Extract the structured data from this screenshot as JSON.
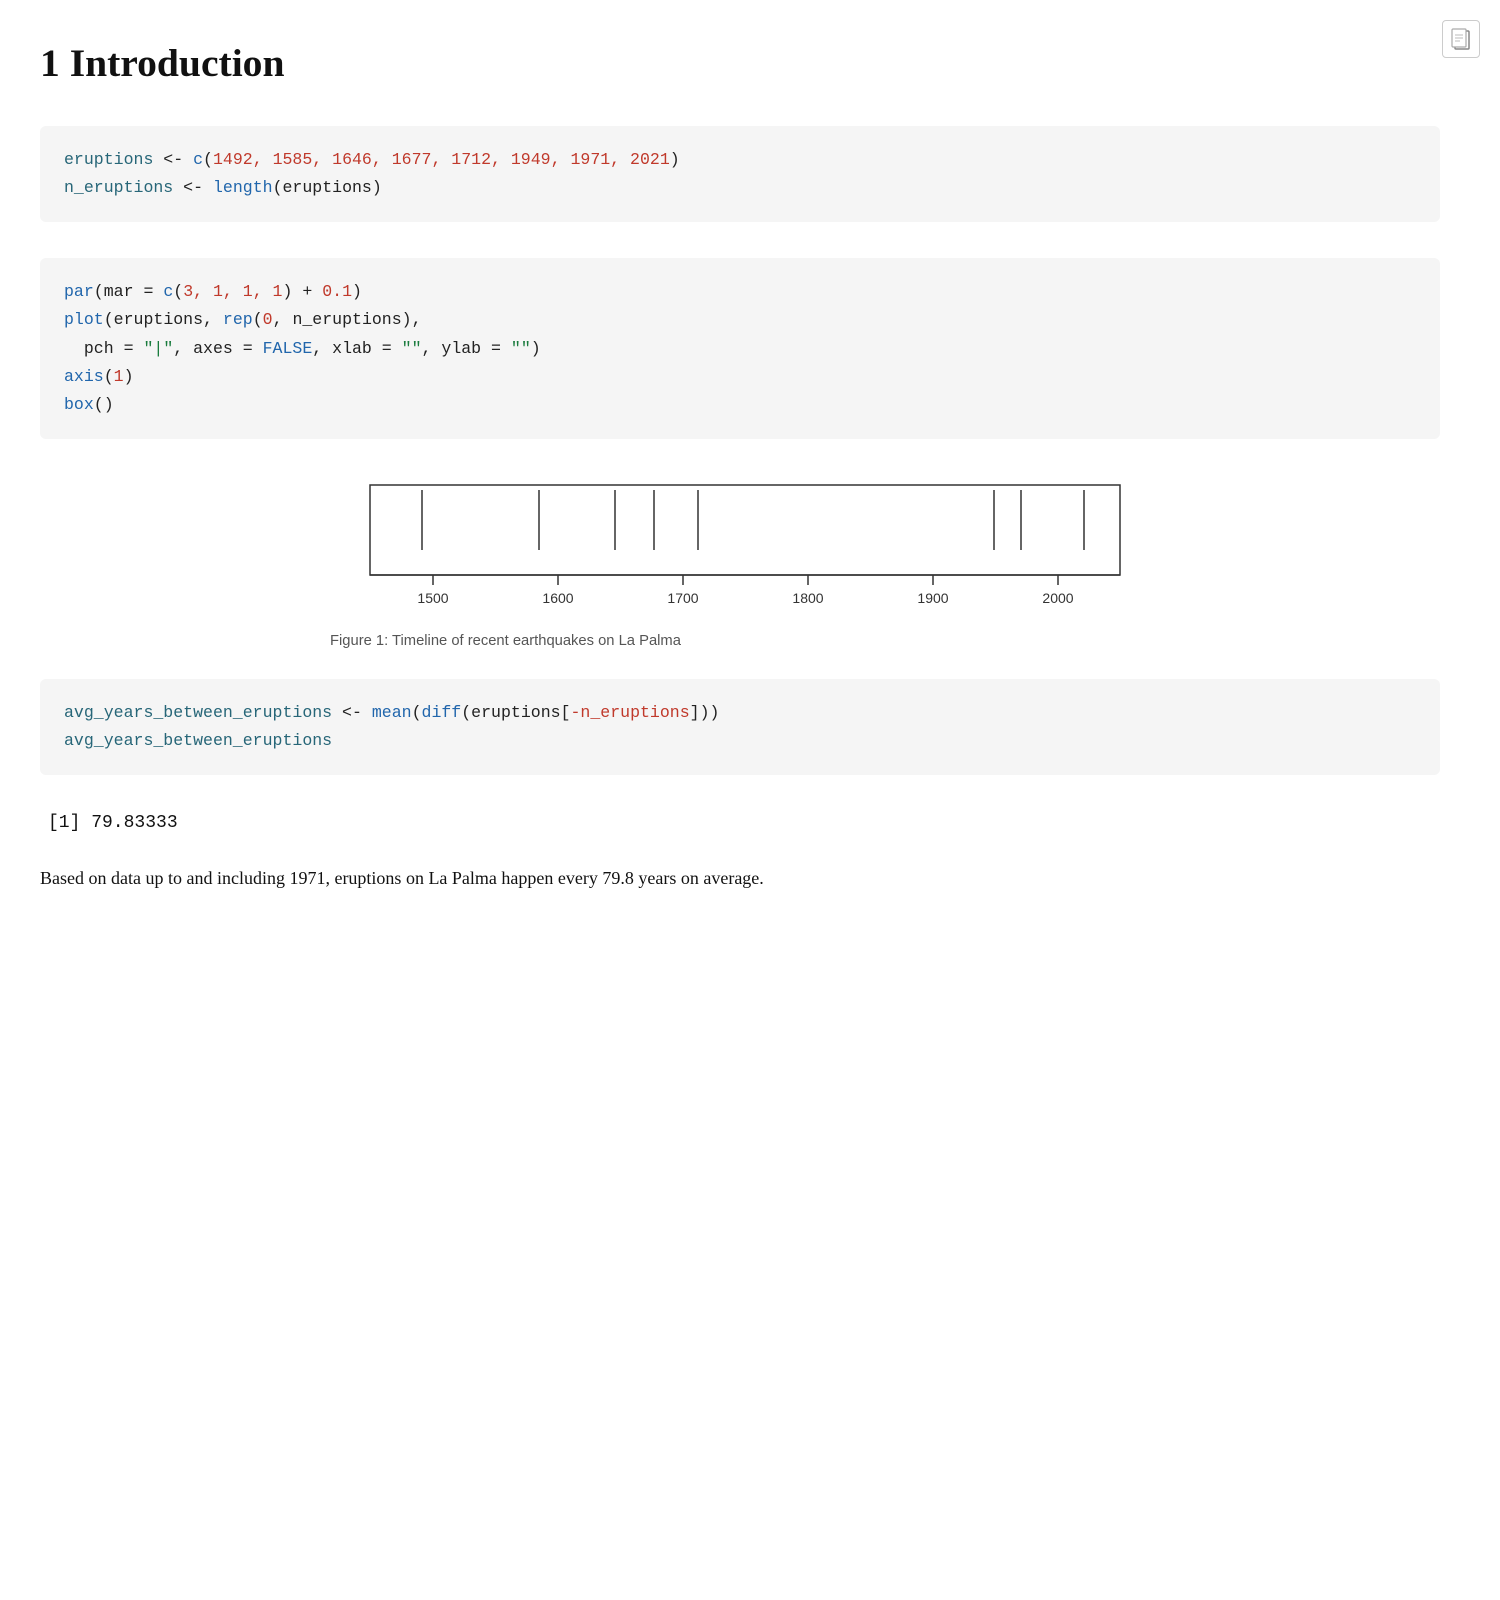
{
  "header": {
    "section_number": "1",
    "title": "Introduction"
  },
  "code_block_1": {
    "lines": [
      {
        "parts": [
          {
            "text": "eruptions",
            "class": "c-teal"
          },
          {
            "text": " <- ",
            "class": ""
          },
          {
            "text": "c",
            "class": "c-blue"
          },
          {
            "text": "(",
            "class": ""
          },
          {
            "text": "1492, 1585, 1646, 1677, 1712, 1949, 1971, 2021",
            "class": "c-red"
          },
          {
            "text": ")",
            "class": ""
          }
        ]
      },
      {
        "parts": [
          {
            "text": "n_eruptions",
            "class": "c-teal"
          },
          {
            "text": " <- ",
            "class": ""
          },
          {
            "text": "length",
            "class": "c-blue"
          },
          {
            "text": "(eruptions)",
            "class": ""
          }
        ]
      }
    ]
  },
  "code_block_2": {
    "lines": [
      {
        "parts": [
          {
            "text": "par",
            "class": "c-blue"
          },
          {
            "text": "(mar = ",
            "class": ""
          },
          {
            "text": "c",
            "class": "c-blue"
          },
          {
            "text": "(",
            "class": ""
          },
          {
            "text": "3, 1, 1, 1",
            "class": "c-red"
          },
          {
            "text": ") + ",
            "class": ""
          },
          {
            "text": "0.1",
            "class": "c-red"
          },
          {
            "text": ")",
            "class": ""
          }
        ]
      },
      {
        "parts": [
          {
            "text": "plot",
            "class": "c-blue"
          },
          {
            "text": "(eruptions, ",
            "class": ""
          },
          {
            "text": "rep",
            "class": "c-blue"
          },
          {
            "text": "(",
            "class": ""
          },
          {
            "text": "0",
            "class": "c-red"
          },
          {
            "text": ", n_eruptions),",
            "class": ""
          }
        ]
      },
      {
        "parts": [
          {
            "text": "  pch = ",
            "class": ""
          },
          {
            "text": "\"|\"",
            "class": "c-green"
          },
          {
            "text": ", axes = ",
            "class": ""
          },
          {
            "text": "FALSE",
            "class": "c-blue"
          },
          {
            "text": ", xlab = ",
            "class": ""
          },
          {
            "text": "\"\"",
            "class": "c-green"
          },
          {
            "text": ", ylab = ",
            "class": ""
          },
          {
            "text": "\"\"",
            "class": "c-green"
          },
          {
            "text": ")",
            "class": ""
          }
        ]
      },
      {
        "parts": [
          {
            "text": "axis",
            "class": "c-blue"
          },
          {
            "text": "(",
            "class": ""
          },
          {
            "text": "1",
            "class": "c-red"
          },
          {
            "text": ")",
            "class": ""
          }
        ]
      },
      {
        "parts": [
          {
            "text": "box",
            "class": "c-blue"
          },
          {
            "text": "()",
            "class": ""
          }
        ]
      }
    ]
  },
  "chart": {
    "eruptions": [
      1492,
      1585,
      1646,
      1677,
      1712,
      1949,
      1971,
      2021
    ],
    "x_min": 1450,
    "x_max": 2050,
    "axis_labels": [
      "1500",
      "1600",
      "1700",
      "1800",
      "1900",
      "2000"
    ],
    "axis_values": [
      1500,
      1600,
      1700,
      1800,
      1900,
      2000
    ]
  },
  "figure_caption": "Figure 1: Timeline of recent earthquakes on La Palma",
  "code_block_3": {
    "lines": [
      {
        "parts": [
          {
            "text": "avg_years_between_eruptions",
            "class": "c-teal"
          },
          {
            "text": " <- ",
            "class": ""
          },
          {
            "text": "mean",
            "class": "c-blue"
          },
          {
            "text": "(",
            "class": ""
          },
          {
            "text": "diff",
            "class": "c-blue"
          },
          {
            "text": "(eruptions[",
            "class": ""
          },
          {
            "text": "-n_eruptions",
            "class": "c-red"
          },
          {
            "text": "]))",
            "class": ""
          }
        ]
      },
      {
        "parts": [
          {
            "text": "avg_years_between_eruptions",
            "class": "c-teal"
          }
        ]
      }
    ]
  },
  "output": "[1] 79.83333",
  "body_text": "Based on data up to and including 1971, eruptions on La Palma happen every 79.8 years on average.",
  "top_right_icon": {
    "symbol": "⊡"
  }
}
